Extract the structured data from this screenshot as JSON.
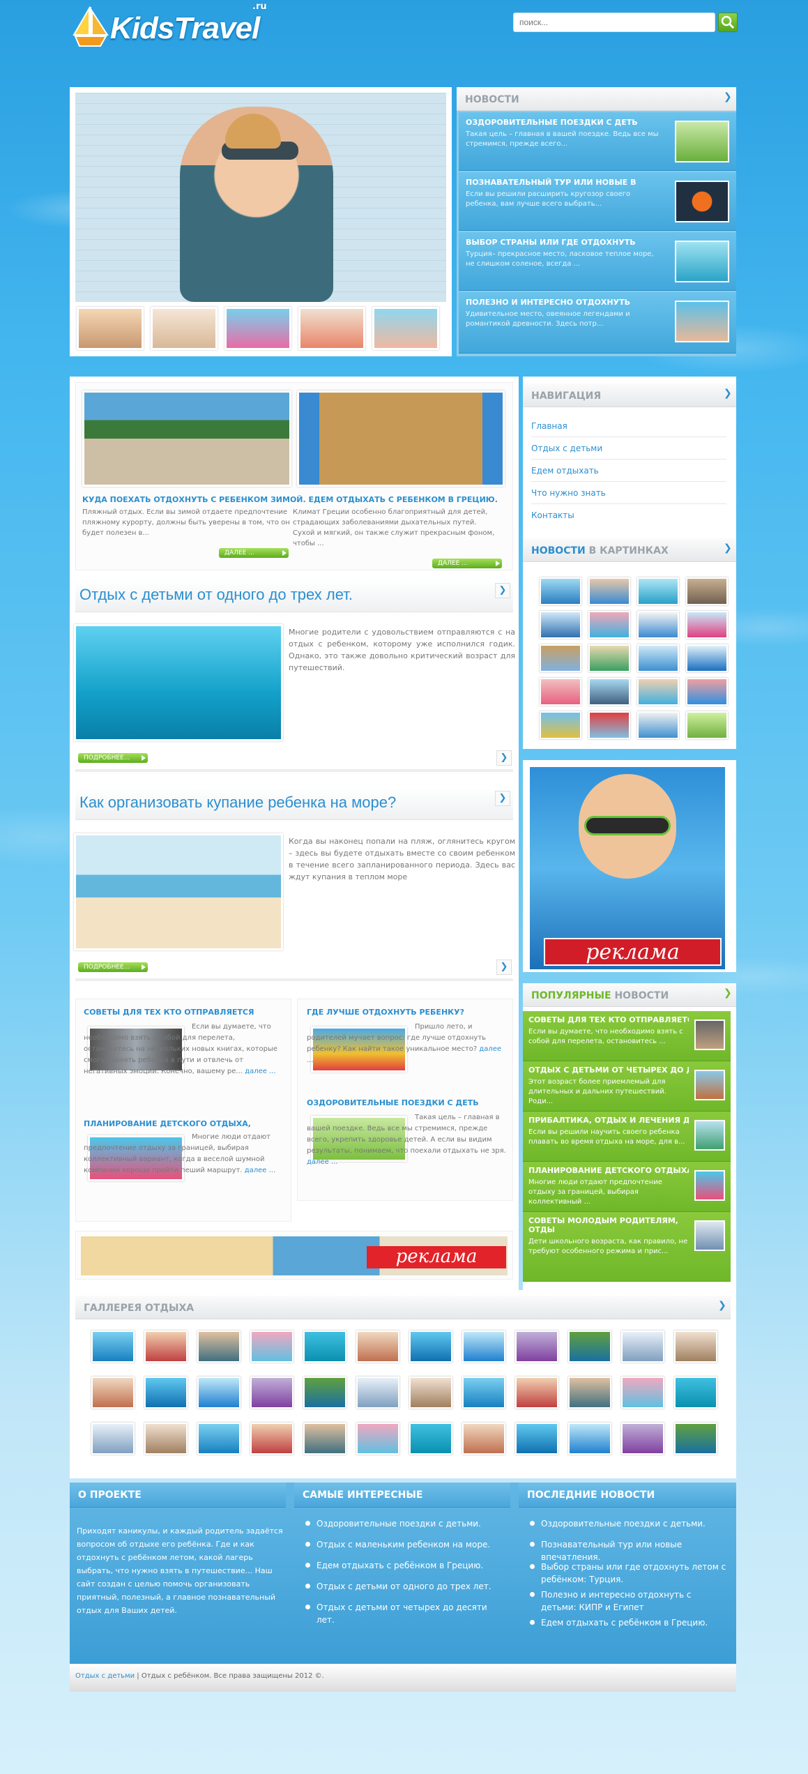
{
  "header": {
    "logo_text": "KidsTravel",
    "logo_suffix": ".ru",
    "search_placeholder": "поиск..."
  },
  "slider": {
    "thumbs": 5
  },
  "news": {
    "title": "НОВОСТИ",
    "items": [
      {
        "title": "ОЗДОРОВИТЕЛЬНЫЕ ПОЕЗДКИ С ДЕТЬ",
        "desc": "Такая цель – главная в вашей поездке. Ведь все мы стремимся, прежде всего..."
      },
      {
        "title": "ПОЗНАВАТЕЛЬНЫЙ ТУР ИЛИ НОВЫЕ В",
        "desc": "Если вы решили расширить кругозор своего ребенка, вам лучше всего выбрать..."
      },
      {
        "title": "ВЫБОР СТРАНЫ ИЛИ ГДЕ ОТДОХНУТЬ",
        "desc": "Турция– прекрасное место, ласковое теплое море, не слишком соленое, всегда ..."
      },
      {
        "title": "ПОЛЕЗНО И ИНТЕРЕСНО ОТДОХНУТЬ",
        "desc": "Удивительное место, овеянное легендами и романтикой древности. Здесь потр..."
      }
    ]
  },
  "featured": {
    "title": "КУДА ПОЕХАТЬ ОТДОХНУТЬ С РЕБЕНКОМ ЗИМОЙ. ЕДЕМ ОТДЫХАТЬ С РЕБЕНКОМ В ГРЕЦИЮ.",
    "text_left": "Пляжный отдых. Если вы зимой отдаете предпочтение",
    "text_left2": "пляжному курорту, должны быть уверены в том, что он",
    "text_left3": "будет полезен в...",
    "text_right": "Климат Греции особенно благоприятный для детей, страдающих заболеваниями дыхательных путей.",
    "text_right2": "Сухой и мягкий, он также служит прекрасным фоном, чтобы ...",
    "more": "ДАЛЕЕ ..."
  },
  "article1": {
    "title": "Отдых с детьми от одного до трех лет.",
    "text": "Многие родители с удовольствием отправляются с на отдых с ребенком, которому уже исполнился годик. Однако, это также довольно критический возраст для путешествий.",
    "more": "ПОДРОБНЕЕ..."
  },
  "article2": {
    "title": "Как организовать купание ребенка на море?",
    "text": "Когда вы наконец попали на пляж, оглянитесь кругом – здесь вы будете отдыхать вместе со своим ребенком в течение всего запланированного периода. Здесь вас ждут купания в теплом море",
    "more": "ПОДРОБНЕЕ..."
  },
  "cats": {
    "c1_title": "СОВЕТЫ ДЛЯ ТЕХ КТО ОТПРАВЛЯЕТСЯ",
    "c1_text": "Если вы думаете, что необходимо взять с собой для перелета, остановитесь на нескольких новых книгах, которые смогут занять ребенка в пути и отвлечь от негативных эмоций. Конечно, вашему ре...",
    "c2_title": "ПЛАНИРОВАНИЕ ДЕТСКОГО ОТДЫХА,",
    "c2_text": "Многие люди отдают предпочтение отдыху за границей, выбирая коллективный вариант, когда в веселой шумной компании хорошо пройти пеший маршрут.",
    "c3_title": "ГДЕ ЛУЧШЕ ОТДОХНУТЬ РЕБЕНКУ?",
    "c3_text": "Пришло лето, и родителей мучает вопрос: где лучше отдохнуть ребенку? Как найти такое уникальное место?",
    "c4_title": "ОЗДОРОВИТЕЛЬНЫЕ ПОЕЗДКИ С ДЕТЬ",
    "c4_text": "Такая цель – главная в вашей поездке. Ведь все мы стремимся, прежде всего, укрепить здоровье детей. А если вы видим результаты, понимаем, что поехали отдыхать не зря.",
    "more": "далее ..."
  },
  "ad": {
    "label": "реклама"
  },
  "sidebar": {
    "nav_title": "НАВИГАЦИЯ",
    "nav": [
      "Главная",
      "Отдых с детьми",
      "Едем отдыхать",
      "Что нужно знать",
      "Контакты"
    ],
    "pics_title_a": "НОВОСТИ",
    "pics_title_b": " В КАРТИНКАХ",
    "pop_title_a": "ПОПУЛЯРНЫЕ",
    "pop_title_b": " НОВОСТИ",
    "pop": [
      {
        "title": "СОВЕТЫ ДЛЯ ТЕХ КТО ОТПРАВЛЯЕТСЯ",
        "desc": "Если вы думаете, что необходимо взять с собой для перелета, остановитесь ..."
      },
      {
        "title": "ОТДЫХ С ДЕТЬМИ ОТ ЧЕТЫРЕХ ДО Д",
        "desc": "Этот возраст более приемлемый для длительных и дальних путешествий. Роди..."
      },
      {
        "title": "ПРИБАЛТИКА, ОТДЫХ И ЛЕЧЕНИЯ ДЛ",
        "desc": "Если вы решили научить своего ребенка плавать во время отдыха на море, для в..."
      },
      {
        "title": "ПЛАНИРОВАНИЕ ДЕТСКОГО ОТДЫХА,",
        "desc": "Многие люди отдают предпочтение отдыху за границей, выбирая коллективный ..."
      },
      {
        "title": "СОВЕТЫ МОЛОДЫМ РОДИТЕЛЯМ, ОТДЫ",
        "desc": "Дети школьного возраста, как правило, не требуют особенного режима и прис..."
      }
    ]
  },
  "gallery": {
    "title": "ГАЛЛЕРЕЯ ОТДЫХА"
  },
  "footer": {
    "about_title": "О ПРОЕКТЕ",
    "about_text": "Приходят каникулы, и каждый родитель задаётся вопросом об отдыхе его ребёнка. Где и как отдохнуть с ребёнком летом, какой лагерь выбрать, что нужно взять в путешествие...   Наш сайт создан с целью помочь организовать приятный, полезный, а главное познавательный отдых для Ваших детей.",
    "interesting_title": "САМЫЕ ИНТЕРЕСНЫЕ",
    "interesting": [
      "Оздоровительные поездки с детьми.",
      "Отдых с маленьким ребенком на море.",
      "Едем отдыхать с ребёнком в Грецию.",
      "Отдых с детьми от одного до трех лет.",
      "Отдых с детьми от четырех до десяти лет."
    ],
    "latest_title": "ПОСЛЕДНИЕ НОВОСТИ",
    "latest": [
      "Оздоровительные поездки с детьми.",
      "Познавательный тур или новые впечатления.",
      "Выбор страны или где отдохнуть летом с ребёнком: Турция.",
      "Полезно и интересно отдохнуть с детьми: КИПР и Египет",
      "Едем отдыхать с ребёнком в Грецию."
    ],
    "copy_link": "Отдых с детьми",
    "copy_text": " | Отдых с ребёнком. Все права защищены 2012 ©."
  },
  "colors": {
    "accent": "#2b8fcf",
    "green": "#6fb82a",
    "blue": "#42a7db"
  }
}
